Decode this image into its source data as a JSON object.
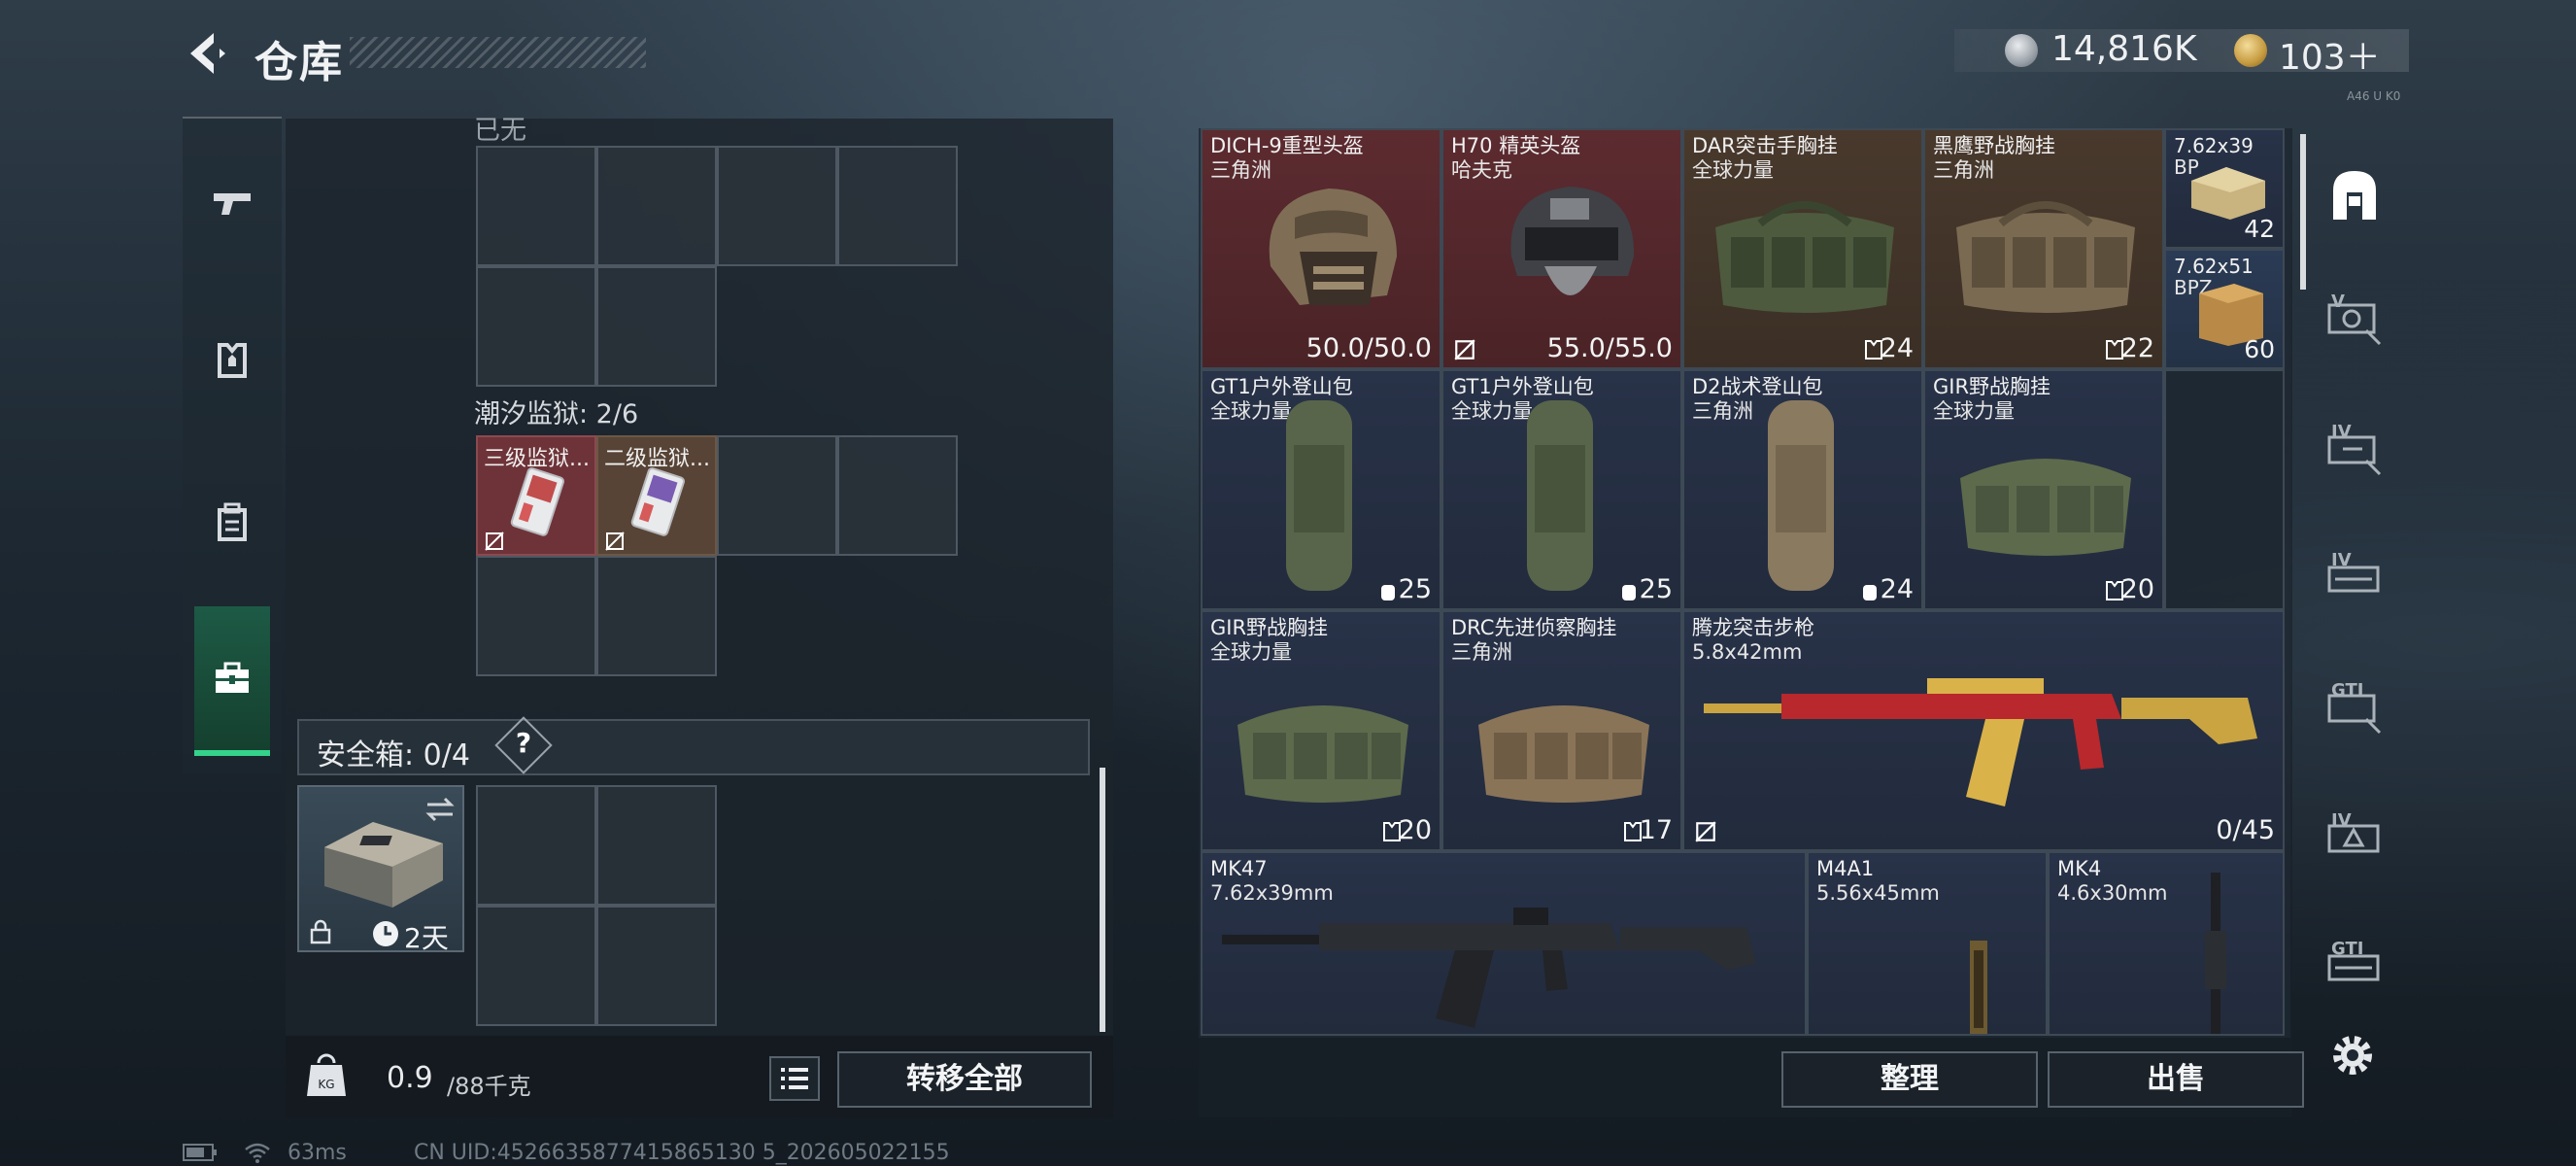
{
  "header": {
    "title": "仓库",
    "coin_value": "14,816K",
    "token_value": "103＋",
    "version_tag": "A46 U K0"
  },
  "left_panel": {
    "top_section_label": "已无",
    "tide_label": "潮汐监狱: 2/6",
    "tide_items": [
      {
        "name": "三级监狱...",
        "color": "#7a3a3f"
      },
      {
        "name": "二级监狱...",
        "color": "#5a4636"
      }
    ],
    "safe_label": "安全箱: 0/4",
    "safe_help": "?",
    "safebox_timer": "2天",
    "weight_value": "0.9",
    "weight_cap": "/88千克",
    "transfer_all": "转移全部"
  },
  "stash": {
    "row1": [
      {
        "name": "DICH-9重型头盔",
        "sub": "三角洲",
        "value": "50.0/50.0",
        "bg": "red"
      },
      {
        "name": "H70 精英头盔",
        "sub": "哈夫克",
        "value": "55.0/55.0",
        "bg": "red"
      },
      {
        "name": "DAR突击手胸挂",
        "sub": "全球力量",
        "value": "24",
        "bg": "brown"
      },
      {
        "name": "黑鹰野战胸挂",
        "sub": "三角洲",
        "value": "22",
        "bg": "brown"
      }
    ],
    "ammo": [
      {
        "name": "7.62x39",
        "sub": "BP",
        "value": "42"
      },
      {
        "name": "7.62x51",
        "sub": "BPZ",
        "value": "60"
      }
    ],
    "row2": [
      {
        "name": "GT1户外登山包",
        "sub": "全球力量",
        "value": "25"
      },
      {
        "name": "GT1户外登山包",
        "sub": "全球力量",
        "value": "25"
      },
      {
        "name": "D2战术登山包",
        "sub": "三角洲",
        "value": "24"
      },
      {
        "name": "GIR野战胸挂",
        "sub": "全球力量",
        "value": "20"
      }
    ],
    "row3": [
      {
        "name": "GIR野战胸挂",
        "sub": "全球力量",
        "value": "20"
      },
      {
        "name": "DRC先进侦察胸挂",
        "sub": "三角洲",
        "value": "17"
      }
    ],
    "rifle": {
      "name": "腾龙突击步枪",
      "sub": "5.8x42mm",
      "value": "0/45"
    },
    "row4": [
      {
        "name": "MK47",
        "sub": "7.62x39mm"
      },
      {
        "name": "M4A1",
        "sub": "5.56x45mm"
      },
      {
        "name": "MK4",
        "sub": "4.6x30mm"
      }
    ],
    "sort": "整理",
    "sell": "出售"
  },
  "right_rail": [
    "V",
    "IV",
    "IV",
    "GTI",
    "IV",
    "GTI"
  ],
  "status": {
    "ping": "63ms",
    "uid": "CN UID:4526635877415865130 5_202605022155"
  }
}
